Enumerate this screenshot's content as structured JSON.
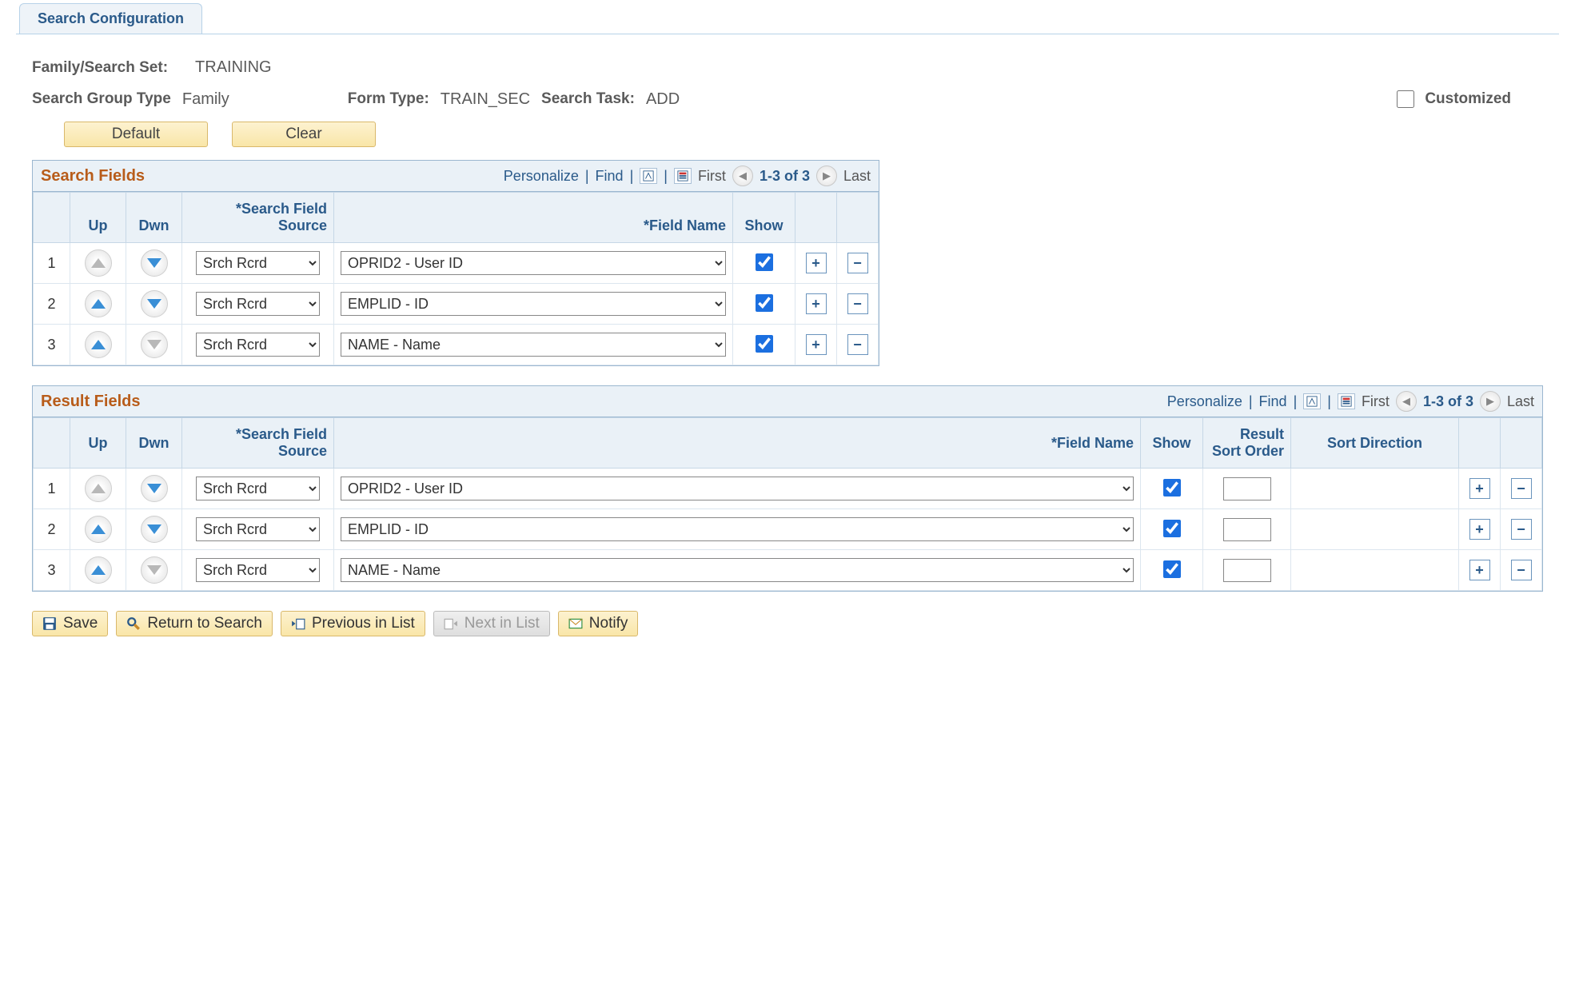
{
  "tab": {
    "label": "Search Configuration"
  },
  "header": {
    "family_label": "Family/Search Set:",
    "family_value": "TRAINING",
    "group_type_label": "Search Group Type",
    "group_type_value": "Family",
    "form_type_label": "Form Type:",
    "form_type_value": "TRAIN_SEC",
    "search_task_label": "Search Task:",
    "search_task_value": "ADD",
    "customized_label": "Customized",
    "btn_default": "Default",
    "btn_clear": "Clear"
  },
  "common": {
    "personalize": "Personalize",
    "find": "Find",
    "first": "First",
    "last": "Last",
    "range": "1-3 of 3",
    "col_up": "Up",
    "col_dwn": "Dwn",
    "col_source": "*Search Field Source",
    "col_fieldname": "*Field Name",
    "col_show": "Show",
    "col_sort_order": "Result Sort Order",
    "col_sort_dir": "Sort Direction"
  },
  "source_options": [
    "Srch Rcrd"
  ],
  "field_options": [
    "OPRID2 - User ID",
    "EMPLID - ID",
    "NAME - Name"
  ],
  "grids": {
    "search": {
      "title": "Search Fields",
      "rows": [
        {
          "n": "1",
          "up_enabled": false,
          "down_enabled": true,
          "source": "Srch Rcrd",
          "field": "OPRID2 - User ID",
          "show": true
        },
        {
          "n": "2",
          "up_enabled": true,
          "down_enabled": true,
          "source": "Srch Rcrd",
          "field": "EMPLID - ID",
          "show": true
        },
        {
          "n": "3",
          "up_enabled": true,
          "down_enabled": false,
          "source": "Srch Rcrd",
          "field": "NAME - Name",
          "show": true
        }
      ]
    },
    "result": {
      "title": "Result Fields",
      "rows": [
        {
          "n": "1",
          "up_enabled": false,
          "down_enabled": true,
          "source": "Srch Rcrd",
          "field": "OPRID2 - User ID",
          "show": true,
          "sort_order": "",
          "sort_dir": ""
        },
        {
          "n": "2",
          "up_enabled": true,
          "down_enabled": true,
          "source": "Srch Rcrd",
          "field": "EMPLID - ID",
          "show": true,
          "sort_order": "",
          "sort_dir": ""
        },
        {
          "n": "3",
          "up_enabled": true,
          "down_enabled": false,
          "source": "Srch Rcrd",
          "field": "NAME - Name",
          "show": true,
          "sort_order": "",
          "sort_dir": ""
        }
      ]
    }
  },
  "toolbar": {
    "save": "Save",
    "return": "Return to Search",
    "prev": "Previous in List",
    "next": "Next in List",
    "notify": "Notify"
  }
}
